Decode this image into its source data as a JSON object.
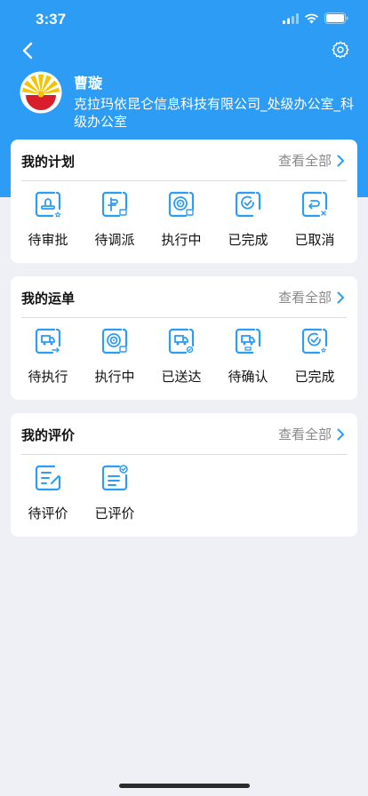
{
  "status_bar": {
    "time": "3:37"
  },
  "profile": {
    "name": "曹璇",
    "organization": "克拉玛依昆仑信息科技有限公司_处级办公室_科级办公室"
  },
  "sections": [
    {
      "title": "我的计划",
      "more_label": "查看全部",
      "items": [
        {
          "label": "待审批",
          "icon": "stamp-approval-icon"
        },
        {
          "label": "待调派",
          "icon": "dispatch-icon"
        },
        {
          "label": "执行中",
          "icon": "in-progress-icon"
        },
        {
          "label": "已完成",
          "icon": "completed-check-icon"
        },
        {
          "label": "已取消",
          "icon": "cancelled-return-icon"
        }
      ]
    },
    {
      "title": "我的运单",
      "more_label": "查看全部",
      "items": [
        {
          "label": "待执行",
          "icon": "truck-pending-icon"
        },
        {
          "label": "执行中",
          "icon": "in-progress-icon"
        },
        {
          "label": "已送达",
          "icon": "truck-delivered-icon"
        },
        {
          "label": "待确认",
          "icon": "truck-confirm-icon"
        },
        {
          "label": "已完成",
          "icon": "completed-check-icon"
        }
      ]
    },
    {
      "title": "我的评价",
      "more_label": "查看全部",
      "items": [
        {
          "label": "待评价",
          "icon": "edit-document-icon"
        },
        {
          "label": "已评价",
          "icon": "reviewed-document-icon"
        }
      ]
    }
  ],
  "colors": {
    "brand": "#2d9cf5",
    "background": "#eef0f6",
    "card": "#ffffff"
  }
}
